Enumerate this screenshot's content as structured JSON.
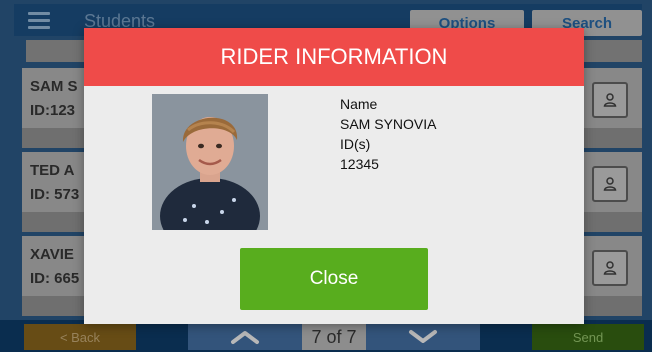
{
  "header": {
    "title": "Students",
    "options_label": "Options",
    "search_label": "Search"
  },
  "students": [
    {
      "name": "SAM S",
      "id": "ID:123"
    },
    {
      "name": "TED A",
      "id": "ID: 573"
    },
    {
      "name": "XAVIE",
      "id": "ID: 665"
    }
  ],
  "footer": {
    "back_label": "< Back",
    "page_count": "7 of 7",
    "send_label": "Send"
  },
  "modal": {
    "title": "RIDER INFORMATION",
    "name_label": "Name",
    "name_value": "SAM SYNOVIA",
    "id_label": "ID(s)",
    "id_value": "12345",
    "close_label": "Close"
  },
  "colors": {
    "modal_header": "#ef4b49",
    "close_button": "#58ad1e",
    "app_header": "#1e5488"
  },
  "icons": [
    "menu-icon",
    "person-icon",
    "chevron-up-icon",
    "chevron-down-icon"
  ]
}
